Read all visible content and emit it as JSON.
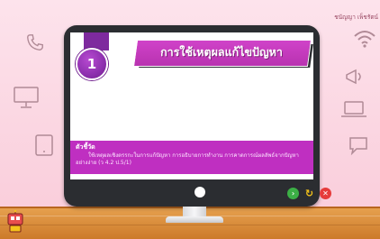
{
  "author": "ชนัญญา เพ็ชรัตน์",
  "lesson": {
    "number": "1",
    "title": "การใช้เหตุผลแก้ไขปัญหา"
  },
  "indicator": {
    "heading": "ตัวชี้วัด",
    "body": "ใช้เหตุผลเชิงตรรกะในการแก้ปัญหา การอธิบายการทำงาน การคาดการณ์ผลลัพธ์จากปัญหาอย่างง่าย (ว 4.2 ป.5/1)"
  },
  "controls": {
    "next_icon": "next-arrow-icon",
    "reload_icon": "reload-icon",
    "close_icon": "close-icon",
    "next_glyph": "›",
    "reload_glyph": "↻",
    "close_glyph": "✕"
  },
  "colors": {
    "background": "#fbd6e2",
    "accent_magenta": "#bf2fc1",
    "badge_purple": "#8d2fae",
    "monitor_frame": "#2b2d31",
    "desk_wood": "#d98c3a",
    "next_green": "#3cb046",
    "close_red": "#e63b3b"
  }
}
